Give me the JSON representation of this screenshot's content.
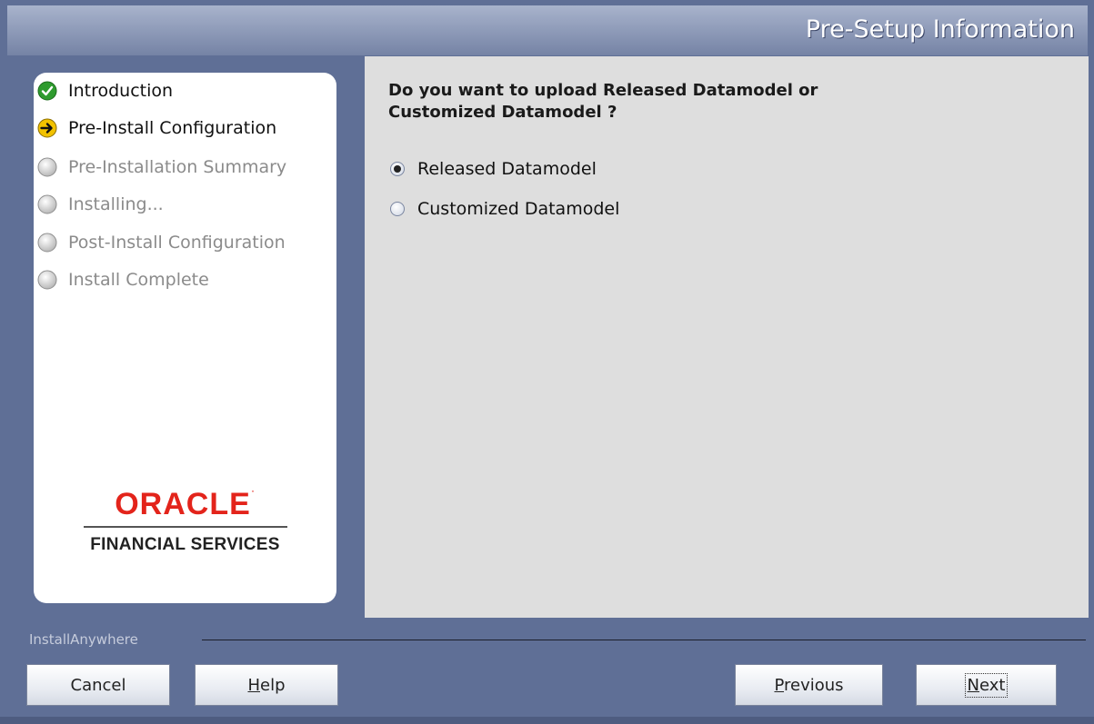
{
  "header": {
    "title": "Pre-Setup Information"
  },
  "steps": [
    {
      "label": "Introduction",
      "state": "done",
      "icon": "check-icon"
    },
    {
      "label": "Pre-Install Configuration",
      "state": "current",
      "icon": "arrow-right-icon"
    },
    {
      "label": "Pre-Installation Summary",
      "state": "pending",
      "icon": "pending-circle-icon"
    },
    {
      "label": "Installing...",
      "state": "pending",
      "icon": "pending-circle-icon"
    },
    {
      "label": "Post-Install Configuration",
      "state": "pending",
      "icon": "pending-circle-icon"
    },
    {
      "label": "Install Complete",
      "state": "pending",
      "icon": "pending-circle-icon"
    }
  ],
  "logo": {
    "brand": "ORACLE",
    "trademark": "·",
    "subtitle": "FINANCIAL SERVICES"
  },
  "content": {
    "question_line1": "Do you want to upload Released Datamodel or",
    "question_line2": "Customized Datamodel ?",
    "options": [
      {
        "label": "Released Datamodel",
        "selected": true
      },
      {
        "label": "Customized Datamodel",
        "selected": false
      }
    ]
  },
  "footer": {
    "label": "InstallAnywhere",
    "cancel": "Cancel",
    "help_mnemonic": "H",
    "help_rest": "elp",
    "previous_mnemonic": "P",
    "previous_rest": "revious",
    "next_mnemonic": "N",
    "next_rest": "ext"
  },
  "colors": {
    "frame": "#5f6f96",
    "content_bg": "#dedede",
    "oracle_red": "#e3241b",
    "done_green": "#2e9b2e",
    "current_yellow": "#f2c200"
  }
}
